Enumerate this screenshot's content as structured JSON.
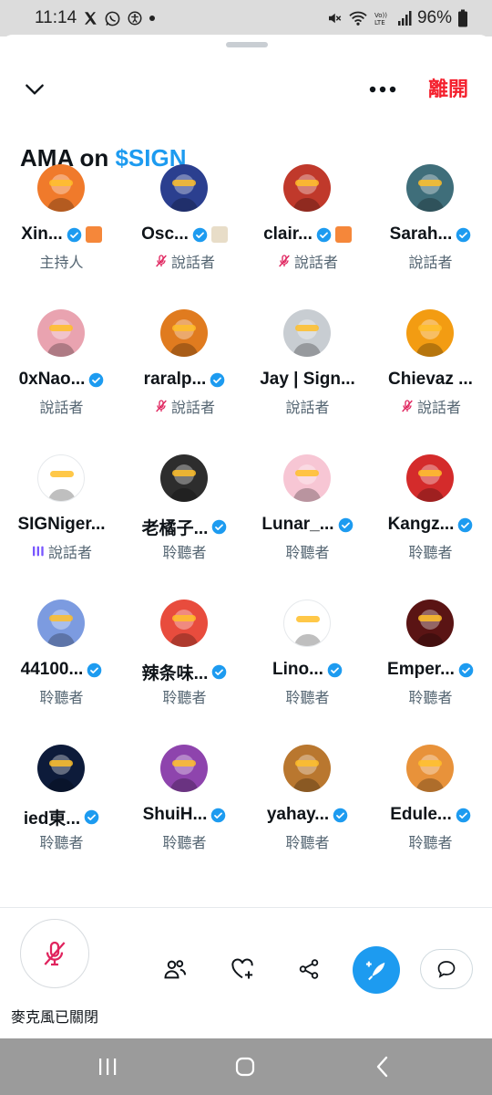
{
  "status_bar": {
    "time": "11:14",
    "battery": "96%",
    "left_icons": [
      "x-logo-icon",
      "whatsapp-icon",
      "accessibility-icon",
      "dot-icon"
    ],
    "right_icons": [
      "mute-icon",
      "wifi-icon",
      "volte-icon",
      "signal-icon",
      "battery-icon"
    ]
  },
  "header": {
    "collapse_icon": "chevron-down-icon",
    "more_icon": "more-icon",
    "leave_label": "離開"
  },
  "space": {
    "title_prefix": "AMA on ",
    "title_highlight": "$SIGN"
  },
  "colors": {
    "accent_blue": "#1d9bf0",
    "leave_red": "#f4212e",
    "muted_pink": "#e0245e",
    "speaking_purple": "#7856ff"
  },
  "participants": [
    {
      "name": "Xin...",
      "role": "主持人",
      "verified": true,
      "badge": "orange-tag",
      "status": "none",
      "avatar": "#f07a2b"
    },
    {
      "name": "Osc...",
      "role": "說話者",
      "verified": true,
      "badge": "beige-tag",
      "status": "muted",
      "avatar": "#2b3f8f"
    },
    {
      "name": "clair...",
      "role": "說話者",
      "verified": true,
      "badge": "orange-tag",
      "status": "muted",
      "avatar": "#c0392b"
    },
    {
      "name": "Sarah...",
      "role": "說話者",
      "verified": true,
      "badge": "none",
      "status": "none",
      "avatar": "#3f6e7a"
    },
    {
      "name": "0xNao...",
      "role": "說話者",
      "verified": true,
      "badge": "none",
      "status": "none",
      "avatar": "#e9a3b0"
    },
    {
      "name": "raralp...",
      "role": "說話者",
      "verified": true,
      "badge": "none",
      "status": "muted",
      "avatar": "#e07b1f"
    },
    {
      "name": "Jay | Sign...",
      "role": "說話者",
      "verified": false,
      "badge": "none",
      "status": "none",
      "avatar": "#c8cdd2"
    },
    {
      "name": "Chievaz ...",
      "role": "說話者",
      "verified": false,
      "badge": "none",
      "status": "muted",
      "avatar": "#f39c12"
    },
    {
      "name": "SIGNiger...",
      "role": "說話者",
      "verified": false,
      "badge": "none",
      "status": "speaking",
      "avatar": "#ffffff"
    },
    {
      "name": "老橘子...",
      "role": "聆聽者",
      "verified": true,
      "badge": "none",
      "status": "none",
      "avatar": "#2d2d2d"
    },
    {
      "name": "Lunar_...",
      "role": "聆聽者",
      "verified": true,
      "badge": "none",
      "status": "none",
      "avatar": "#f7c6d4"
    },
    {
      "name": "Kangz...",
      "role": "聆聽者",
      "verified": true,
      "badge": "none",
      "status": "none",
      "avatar": "#d42b2b"
    },
    {
      "name": "44100...",
      "role": "聆聽者",
      "verified": true,
      "badge": "none",
      "status": "none",
      "avatar": "#7c9be0"
    },
    {
      "name": "辣条味...",
      "role": "聆聽者",
      "verified": true,
      "badge": "none",
      "status": "none",
      "avatar": "#e84c3d"
    },
    {
      "name": "Lino...",
      "role": "聆聽者",
      "verified": true,
      "badge": "none",
      "status": "none",
      "avatar": "#ffffff"
    },
    {
      "name": "Emper...",
      "role": "聆聽者",
      "verified": true,
      "badge": "none",
      "status": "none",
      "avatar": "#5a1414"
    },
    {
      "name": "ied東...",
      "role": "聆聽者",
      "verified": true,
      "badge": "none",
      "status": "none",
      "avatar": "#0d1b3a"
    },
    {
      "name": "ShuiH...",
      "role": "聆聽者",
      "verified": true,
      "badge": "none",
      "status": "none",
      "avatar": "#8e44ad"
    },
    {
      "name": "yahay...",
      "role": "聆聽者",
      "verified": true,
      "badge": "none",
      "status": "none",
      "avatar": "#b9772f"
    },
    {
      "name": "Edule...",
      "role": "聆聽者",
      "verified": true,
      "badge": "none",
      "status": "none",
      "avatar": "#e8923a"
    }
  ],
  "controls": {
    "mic_label": "麥克風已關閉",
    "mic_icon": "mic-off-icon",
    "actions": [
      "people-icon",
      "heart-plus-icon",
      "share-icon",
      "compose-icon",
      "chat-icon"
    ]
  },
  "nav": {
    "items": [
      "recents-icon",
      "home-icon",
      "back-icon"
    ]
  }
}
